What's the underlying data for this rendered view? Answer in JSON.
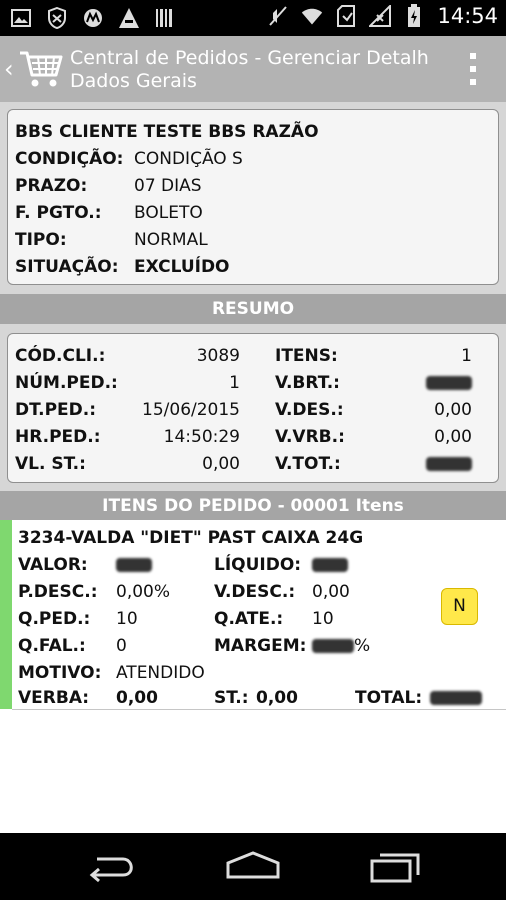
{
  "status_bar": {
    "time": "14:54",
    "icons": [
      "image-icon",
      "security-icon",
      "motorola-icon",
      "signal-arrow-icon",
      "barcode-icon",
      "mute-icon",
      "wifi-icon",
      "sd-card-icon",
      "signal-icon",
      "battery-icon"
    ]
  },
  "action_bar": {
    "title": "Central de Pedidos - Gerenciar Detalh...",
    "subtitle": "Dados Gerais",
    "icons": [
      "back-chevron-icon",
      "cart-icon",
      "overflow-menu-icon"
    ]
  },
  "client": {
    "name": "BBS CLIENTE TESTE BBS RAZÃO",
    "fields": [
      {
        "label": "CONDIÇÃO:",
        "value": "CONDIÇÃO S",
        "bold": false
      },
      {
        "label": "PRAZO:",
        "value": "07 DIAS",
        "bold": false
      },
      {
        "label": "F. PGTO.:",
        "value": "BOLETO",
        "bold": false
      },
      {
        "label": "TIPO:",
        "value": "NORMAL",
        "bold": false
      },
      {
        "label": "SITUAÇÃO:",
        "value": "EXCLUÍDO",
        "bold": true
      }
    ]
  },
  "resumo": {
    "title": "RESUMO",
    "left": [
      {
        "label": "CÓD.CLI.:",
        "value": "3089"
      },
      {
        "label": "NÚM.PED.:",
        "value": "1"
      },
      {
        "label": "DT.PED.:",
        "value": "15/06/2015"
      },
      {
        "label": "HR.PED.:",
        "value": "14:50:29"
      },
      {
        "label": "VL. ST.:",
        "value": "0,00"
      }
    ],
    "right": [
      {
        "label": "ITENS:",
        "value": "1",
        "hidden": false
      },
      {
        "label": "V.BRT.:",
        "value": "",
        "hidden": true
      },
      {
        "label": "V.DES.:",
        "value": "0,00",
        "hidden": false
      },
      {
        "label": "V.VRB.:",
        "value": "0,00",
        "hidden": false
      },
      {
        "label": "V.TOT.:",
        "value": "",
        "hidden": true
      }
    ]
  },
  "itens": {
    "title": "ITENS DO PEDIDO - 00001 Itens",
    "item": {
      "name": "3234-VALDA \"DIET\" PAST CAIXA 24G",
      "valor_label": "VALOR:",
      "liquido_label": "LÍQUIDO:",
      "pdesc_label": "P.DESC.:",
      "pdesc_value": "0,00%",
      "vdesc_label": "V.DESC.:",
      "vdesc_value": "0,00",
      "qped_label": "Q.PED.:",
      "qped_value": "10",
      "qate_label": "Q.ATE.:",
      "qate_value": "10",
      "qfal_label": "Q.FAL.:",
      "qfal_value": "0",
      "margem_label": "MARGEM:",
      "margem_suffix": "%",
      "motivo_label": "MOTIVO:",
      "motivo_value": "ATENDIDO",
      "verba_label": "VERBA:",
      "verba_value": "0,00",
      "st_label": "ST.:",
      "st_value": "0,00",
      "total_label": "TOTAL:",
      "badge": "N",
      "accent_color": "#7fd86f",
      "badge_color": "#ffe84a"
    }
  },
  "nav_bar": {
    "icons": [
      "back-icon",
      "home-icon",
      "recent-apps-icon"
    ]
  }
}
